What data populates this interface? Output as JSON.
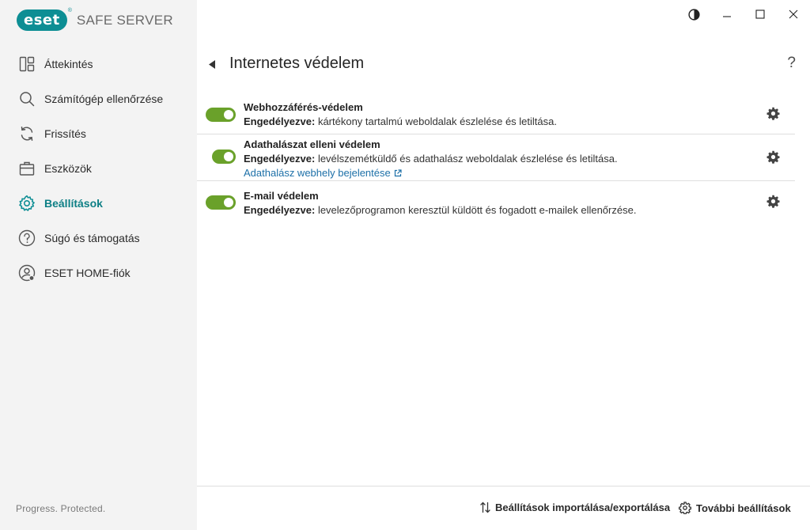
{
  "app": {
    "brand": "eset",
    "product": "SAFE SERVER",
    "tagline": "Progress. Protected.",
    "accent": "#0d8e94",
    "toggle_on_color": "#6aa12a"
  },
  "window_controls": [
    "contrast-icon",
    "minimize-icon",
    "maximize-icon",
    "close-icon"
  ],
  "sidebar": {
    "items": [
      {
        "label": "Áttekintés",
        "icon": "overview-icon"
      },
      {
        "label": "Számítógép ellenőrzése",
        "icon": "search-icon"
      },
      {
        "label": "Frissítés",
        "icon": "refresh-icon"
      },
      {
        "label": "Eszközök",
        "icon": "briefcase-icon"
      },
      {
        "label": "Beállítások",
        "icon": "gear-icon",
        "active": true
      },
      {
        "label": "Súgó és támogatás",
        "icon": "help-icon"
      },
      {
        "label": "ESET HOME-fiók",
        "icon": "account-icon"
      }
    ]
  },
  "main": {
    "title": "Internetes védelem",
    "help": "?",
    "rows": [
      {
        "title": "Webhozzáférés-védelem",
        "state": "Engedélyezve:",
        "desc": " kártékony tartalmú weboldalak észlelése és letiltása.",
        "enabled": true
      },
      {
        "title": "Adathalászat elleni védelem",
        "state": "Engedélyezve:",
        "desc": " levélszemétküldő és adathalász weboldalak észlelése és letiltása.",
        "link": "Adathalász webhely bejelentése",
        "enabled": true
      },
      {
        "title": "E-mail védelem",
        "state": "Engedélyezve:",
        "desc": " levelezőprogramon keresztül küldött és fogadott e-mailek ellenőrzése.",
        "enabled": true
      }
    ]
  },
  "bottom": {
    "import_export": "Beállítások importálása/exportálása",
    "more_settings": "További beállítások"
  }
}
